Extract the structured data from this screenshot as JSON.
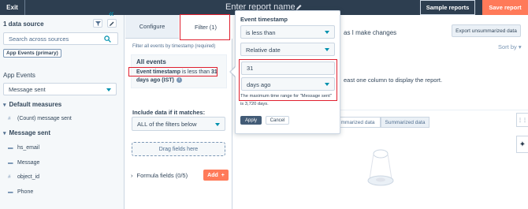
{
  "topbar": {
    "exit_label": "Exit",
    "report_name": "Enter report name",
    "sample_reports_label": "Sample reports",
    "save_report_label": "Save report"
  },
  "left_panel": {
    "datasource_title": "1 data source",
    "search_placeholder": "Search across sources",
    "source_tag": "App Events (primary)",
    "events_label": "App Events",
    "event_selected": "Message sent",
    "default_measures": "Default measures",
    "measure_item": "(Count) message sent",
    "message_sent_section": "Message sent",
    "properties": [
      {
        "icon": "text",
        "label": "hs_email"
      },
      {
        "icon": "text",
        "label": "Message"
      },
      {
        "icon": "number",
        "label": "object_id"
      },
      {
        "icon": "text",
        "label": "Phone"
      }
    ]
  },
  "mid_panel": {
    "tab_configure": "Configure",
    "tab_filter": "Filter (1)",
    "filter_hint": "Filter all events by timestamp (required)",
    "all_events": "All events",
    "event_filter_prefix": "Event timestamp",
    "event_filter_middle": "is less than",
    "event_filter_value": "31",
    "event_filter_suffix": "days ago (IST)",
    "include_label": "Include data if it matches:",
    "include_selected": "ALL of the filters below",
    "drop_zone": "Drag fields here",
    "formula_label": "Formula fields (0/5)",
    "add_label": "Add"
  },
  "main": {
    "make_changes_text": "as I make changes",
    "export_label": "Export unsummarized data",
    "sort_label": "Sort by",
    "least_one_text": "east one column to display the report.",
    "unsummarized_label": "mmarized data",
    "summarized_label": "Summarized data"
  },
  "popover": {
    "title": "Event timestamp",
    "operator": "is less than",
    "date_type": "Relative date",
    "value": "31",
    "unit": "days ago",
    "note_line1": "The maximum time range for \"Message sent\"",
    "note_line2": "is 3,720 days.",
    "apply_label": "Apply",
    "cancel_label": "Cancel"
  },
  "colors": {
    "topbar_bg": "#2d3e50",
    "accent_orange": "#ff7a59",
    "link_teal": "#0091ae",
    "highlight_red": "#e0202f"
  }
}
